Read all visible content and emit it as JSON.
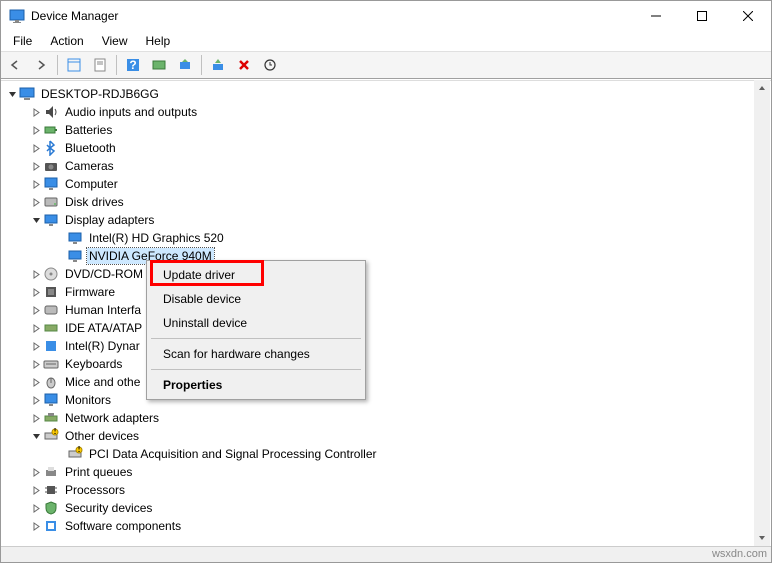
{
  "window": {
    "title": "Device Manager"
  },
  "menus": {
    "file": "File",
    "action": "Action",
    "view": "View",
    "help": "Help"
  },
  "tree": {
    "root": "DESKTOP-RDJB6GG",
    "nodes": [
      {
        "label": "Audio inputs and outputs",
        "expander": "r"
      },
      {
        "label": "Batteries",
        "expander": "r"
      },
      {
        "label": "Bluetooth",
        "expander": "r"
      },
      {
        "label": "Cameras",
        "expander": "r"
      },
      {
        "label": "Computer",
        "expander": "r"
      },
      {
        "label": "Disk drives",
        "expander": "r"
      },
      {
        "label": "Display adapters",
        "expander": "d",
        "children": [
          {
            "label": "Intel(R) HD Graphics 520"
          },
          {
            "label": "NVIDIA GeForce 940M",
            "selected": true
          }
        ]
      },
      {
        "label": "DVD/CD-ROM",
        "expander": "r"
      },
      {
        "label": "Firmware",
        "expander": "r"
      },
      {
        "label": "Human Interfa",
        "expander": "r"
      },
      {
        "label": "IDE ATA/ATAP",
        "expander": "r"
      },
      {
        "label": "Intel(R) Dynar",
        "expander": "r"
      },
      {
        "label": "Keyboards",
        "expander": "r"
      },
      {
        "label": "Mice and othe",
        "expander": "r"
      },
      {
        "label": "Monitors",
        "expander": "r"
      },
      {
        "label": "Network adapters",
        "expander": "r"
      },
      {
        "label": "Other devices",
        "expander": "d",
        "children": [
          {
            "label": "PCI Data Acquisition and Signal Processing Controller"
          }
        ]
      },
      {
        "label": "Print queues",
        "expander": "r"
      },
      {
        "label": "Processors",
        "expander": "r"
      },
      {
        "label": "Security devices",
        "expander": "r"
      },
      {
        "label": "Software components",
        "expander": "r"
      }
    ]
  },
  "context_menu": {
    "update": "Update driver",
    "disable": "Disable device",
    "uninstall": "Uninstall device",
    "scan": "Scan for hardware changes",
    "properties": "Properties"
  },
  "watermark": "wsxdn.com"
}
